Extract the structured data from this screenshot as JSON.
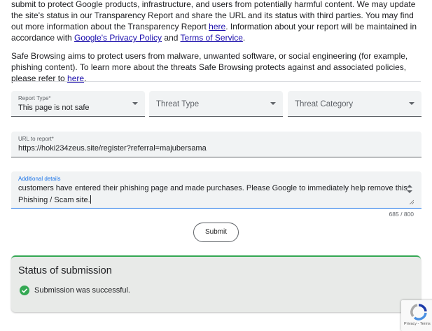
{
  "intro": {
    "p1_text1": "submit to protect Google products, infrastructure, and users from potentially harmful content. We may update the site's status in our Transparency Report and share the URL and its status with third parties. You may find out more information about the Transparency Report ",
    "p1_link1": "here",
    "p1_text2": ". Information about your report will be maintained in accordance with ",
    "p1_link2": "Google's Privacy Policy",
    "p1_text3": " and ",
    "p1_link3": "Terms of Service",
    "p1_text4": ".",
    "p2_text1": "Safe Browsing aims to protect users from malware, unwanted software, or social engineering (for example, phishing content). To learn more about the threats Safe Browsing protects against and associated policies, please refer to ",
    "p2_link": "here",
    "p2_text2": "."
  },
  "form": {
    "report_type": {
      "label": "Report Type*",
      "value": "This page is not safe"
    },
    "threat_type": {
      "placeholder": "Threat Type"
    },
    "threat_category": {
      "placeholder": "Threat Category"
    },
    "url": {
      "label": "URL to report*",
      "value": "https://hoki234zeus.site/register?referral=majubersama"
    },
    "details": {
      "label": "Additional details",
      "line1": "customers have entered their phishing page and made purchases. Please Google to immediately help remove this",
      "line2": "Phishing / Scam site.",
      "counter": "685 / 800"
    },
    "submit_label": "Submit"
  },
  "status": {
    "title": "Status of submission",
    "message": "Submission was successful.",
    "color": "#34a853"
  },
  "recaptcha": {
    "terms": "Privacy - Terms"
  }
}
